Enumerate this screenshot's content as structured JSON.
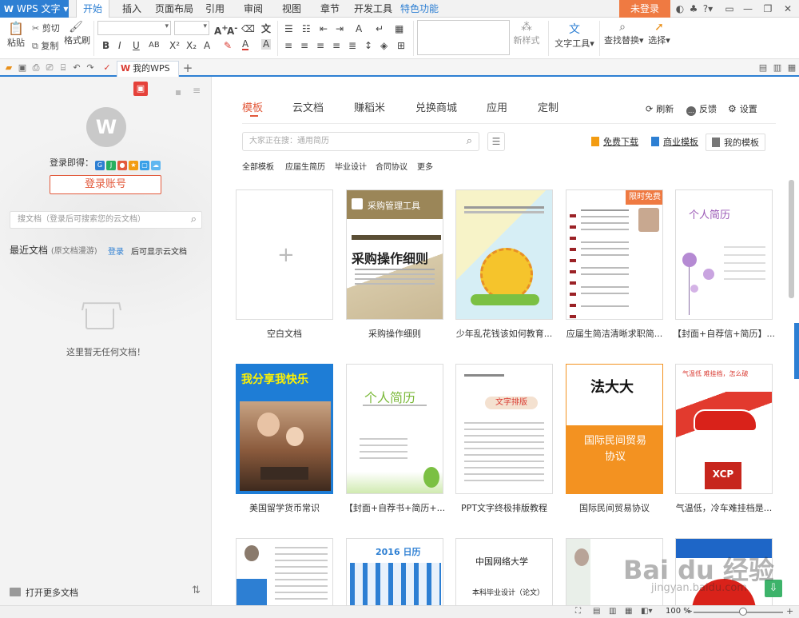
{
  "window": {
    "app_name": "WPS 文字",
    "menu_tabs": [
      "开始",
      "插入",
      "页面布局",
      "引用",
      "审阅",
      "视图",
      "章节",
      "开发工具",
      "特色功能"
    ],
    "login_button": "未登录"
  },
  "toolbar": {
    "paste": "粘贴",
    "cut": "剪切",
    "copy": "复制",
    "format_painter": "格式刷",
    "new_style": "新样式",
    "text_tools": "文字工具",
    "find_replace": "查找替换",
    "select": "选择"
  },
  "quick_access": {
    "doc_tab": "我的WPS",
    "add_tab": "+"
  },
  "sidebar": {
    "login_via": "登录即得：",
    "login_account": "登录账号",
    "search_placeholder": "搜文档（登录后可搜索您的云文档）",
    "recent_title": "最近文档",
    "recent_sub": "(原文档漫游)",
    "login_link": "登录",
    "login_after": "后可显示云文档",
    "empty_text": "这里暂无任何文档！",
    "open_more": "打开更多文档",
    "social_colors": [
      "#2d7fd3",
      "#e25a3c",
      "#f39c12",
      "#27ae60",
      "#3aa0e8",
      "#e5413a"
    ]
  },
  "main": {
    "tabs": [
      "模板",
      "云文档",
      "赚稻米",
      "兑换商城",
      "应用",
      "定制"
    ],
    "refresh": "刷新",
    "feedback": "反馈",
    "settings": "设置",
    "search_placeholder": "大家正在搜：通用简历",
    "free_download": "免费下载",
    "business_templates": "商业模板",
    "my_templates": "我的模板",
    "categories": [
      "全部模板",
      "应届生简历",
      "毕业设计",
      "合同协议",
      "更多"
    ],
    "cards": [
      {
        "label": "空白文档",
        "thumb": "blank"
      },
      {
        "label": "采购操作细则",
        "thumb": "purchase",
        "t1": "采购管理工具",
        "t2": "采购操作细则"
      },
      {
        "label": "少年乱花钱该如何教育...",
        "thumb": "kids"
      },
      {
        "label": "应届生简洁清晰求职简...",
        "thumb": "resume1",
        "badge": "限时免费"
      },
      {
        "label": "【封面+自荐信+简历】...",
        "thumb": "resume2",
        "t1": "个人简历"
      },
      {
        "label": "美国留学货币常识",
        "thumb": "photo",
        "t1": "我分享我快乐"
      },
      {
        "label": "【封面+自荐书+简历+...",
        "thumb": "resume3",
        "t1": "个人简历"
      },
      {
        "label": "PPT文字终极排版教程",
        "thumb": "ppt",
        "t1": "文字排版"
      },
      {
        "label": "国际民间贸易协议",
        "thumb": "trade",
        "t1": "法大大",
        "t2": "国际民间贸易协议"
      },
      {
        "label": "气温低，冷车难挂档是...",
        "thumb": "car",
        "t1": "气温低 难挂档，怎么破"
      },
      {
        "label": "",
        "thumb": "resume4"
      },
      {
        "label": "",
        "thumb": "calendar",
        "t1": "2016 日历"
      },
      {
        "label": "",
        "thumb": "thesis",
        "t1": "中国网络大学",
        "t2": "本科毕业设计（论文）"
      },
      {
        "label": "",
        "thumb": "resume5"
      }
    ]
  },
  "status": {
    "zoom": "100 %"
  },
  "watermark": {
    "brand": "Bai du 经验",
    "url": "jingyan.baidu.com"
  }
}
